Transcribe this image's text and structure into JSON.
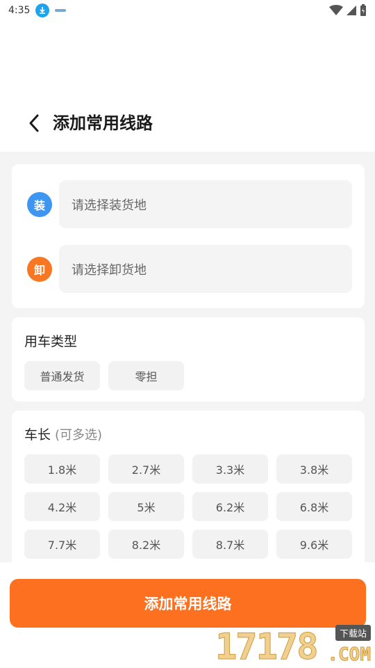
{
  "status_bar": {
    "time": "4:35"
  },
  "header": {
    "title": "添加常用线路"
  },
  "address": {
    "load_badge": "装",
    "load_placeholder": "请选择装货地",
    "unload_badge": "卸",
    "unload_placeholder": "请选择卸货地"
  },
  "vehicle_type": {
    "title": "用车类型",
    "options": [
      "普通发货",
      "零担"
    ]
  },
  "vehicle_length": {
    "title": "车长",
    "subtitle": "(可多选)",
    "options": [
      "1.8米",
      "2.7米",
      "3.3米",
      "3.8米",
      "4.2米",
      "5米",
      "6.2米",
      "6.8米",
      "7.7米",
      "8.2米",
      "8.7米",
      "9.6米"
    ]
  },
  "submit": {
    "label": "添加常用线路"
  },
  "watermark": {
    "number": "17178",
    "tag": "下载站",
    "domain": ".COM"
  },
  "colors": {
    "accent": "#fc701f",
    "load_badge": "#3e96f2",
    "unload_badge": "#f77723"
  }
}
